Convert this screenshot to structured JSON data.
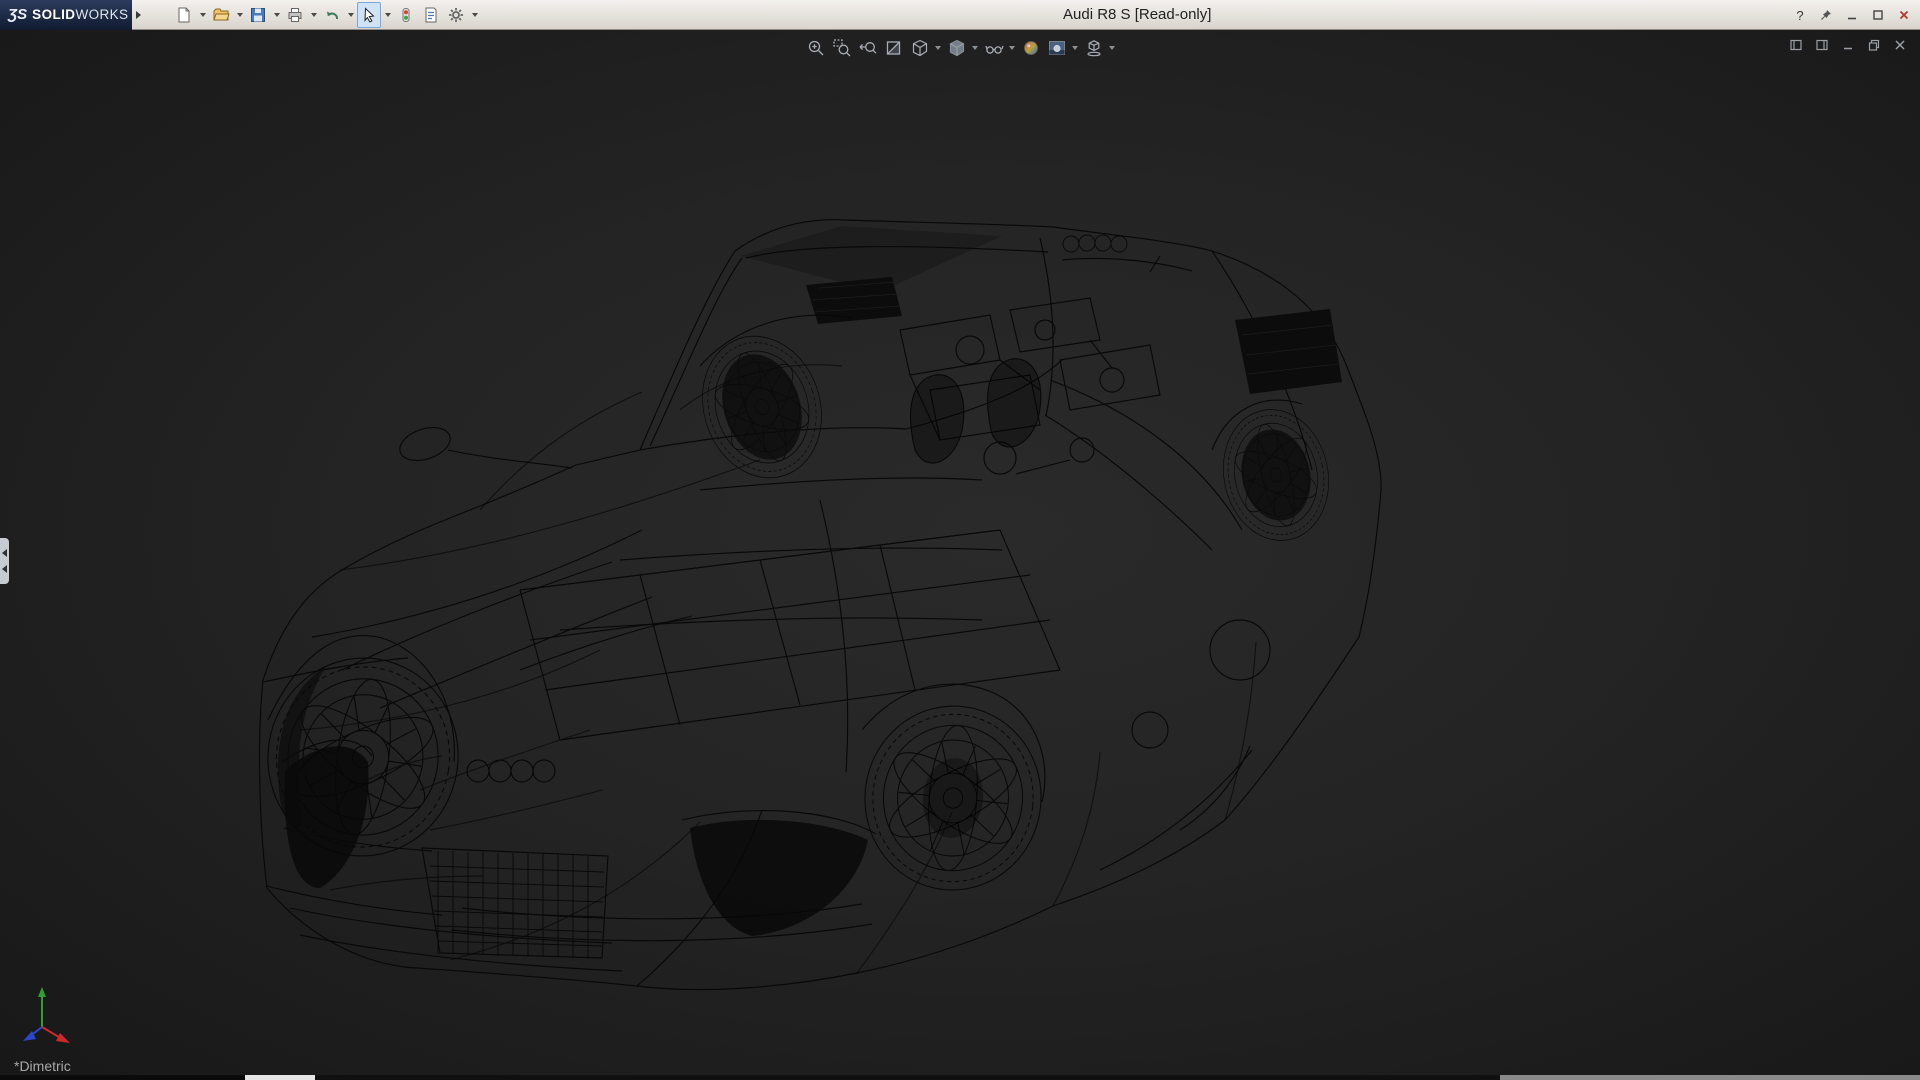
{
  "app": {
    "brand_glyph": "ƷS",
    "brand_name_bold": "SOLID",
    "brand_name_light": "WORKS",
    "window_title": "Audi R8 S [Read-only]",
    "help_glyph": "?"
  },
  "main_toolbar": {
    "items": [
      "new",
      "open",
      "save",
      "print",
      "undo",
      "select",
      "rebuild",
      "file-properties",
      "options"
    ]
  },
  "headsup_toolbar": {
    "items": [
      "zoom-to-fit",
      "zoom-to-area",
      "previous-view",
      "section-view",
      "view-orientation",
      "display-style",
      "hide-show-items",
      "edit-appearance",
      "apply-scene",
      "view-settings"
    ]
  },
  "doc_window_controls": [
    "toggle-left-pane",
    "toggle-right-pane",
    "minimize",
    "restore",
    "close"
  ],
  "viewport": {
    "orientation_label": "*Dimetric",
    "wireframe_color": "#070707",
    "background_center": "#2a2a2a",
    "background_edge": "#181818",
    "triad_colors": {
      "x": "#cc2a2a",
      "y": "#2fa12f",
      "z": "#2a46cc"
    }
  }
}
